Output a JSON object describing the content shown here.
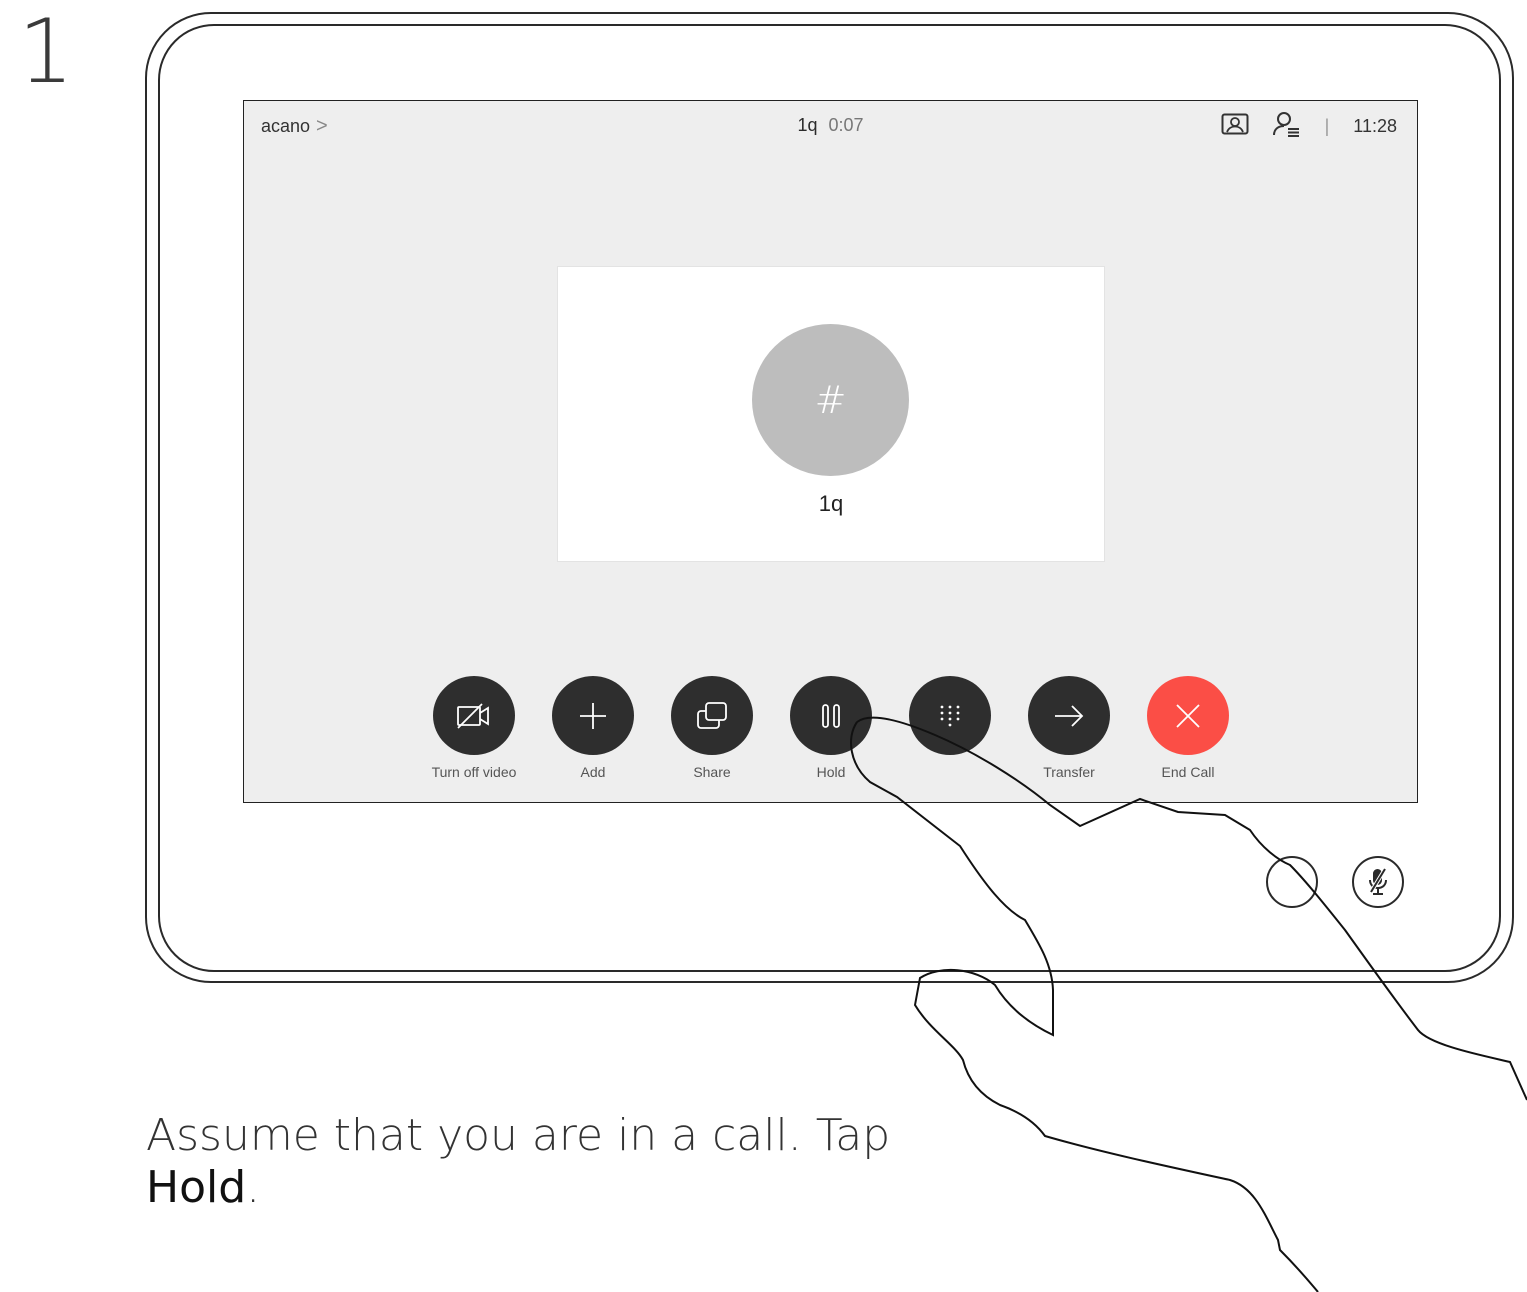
{
  "step": {
    "number": "1"
  },
  "topbar": {
    "room_name": "acano",
    "chevron": ">",
    "call_name": "1q",
    "call_duration": "0:07",
    "self_view_icon": "self-view-icon",
    "participants_icon": "participants-icon",
    "separator": "|",
    "time": "11:28"
  },
  "call_card": {
    "avatar_text": "#",
    "caller_name": "1q"
  },
  "controls": [
    {
      "id": "turn-off-video",
      "label": "Turn off video",
      "icon": "camera-off-icon",
      "color": "#2e2e2e"
    },
    {
      "id": "add",
      "label": "Add",
      "icon": "plus-icon",
      "color": "#2e2e2e"
    },
    {
      "id": "share",
      "label": "Share",
      "icon": "share-screen-icon",
      "color": "#2e2e2e"
    },
    {
      "id": "hold",
      "label": "Hold",
      "icon": "pause-icon",
      "color": "#2e2e2e"
    },
    {
      "id": "keypad",
      "label": "",
      "icon": "keypad-icon",
      "color": "#2e2e2e"
    },
    {
      "id": "transfer",
      "label": "Transfer",
      "icon": "arrow-right-icon",
      "color": "#2e2e2e"
    },
    {
      "id": "end-call",
      "label": "End Call",
      "icon": "close-icon",
      "color": "#fb4e46"
    }
  ],
  "bezel": {
    "mute_icon": "microphone-muted-icon"
  },
  "caption": {
    "line1": "Assume that you are in a call. Tap",
    "bold": "Hold",
    "end": "."
  }
}
